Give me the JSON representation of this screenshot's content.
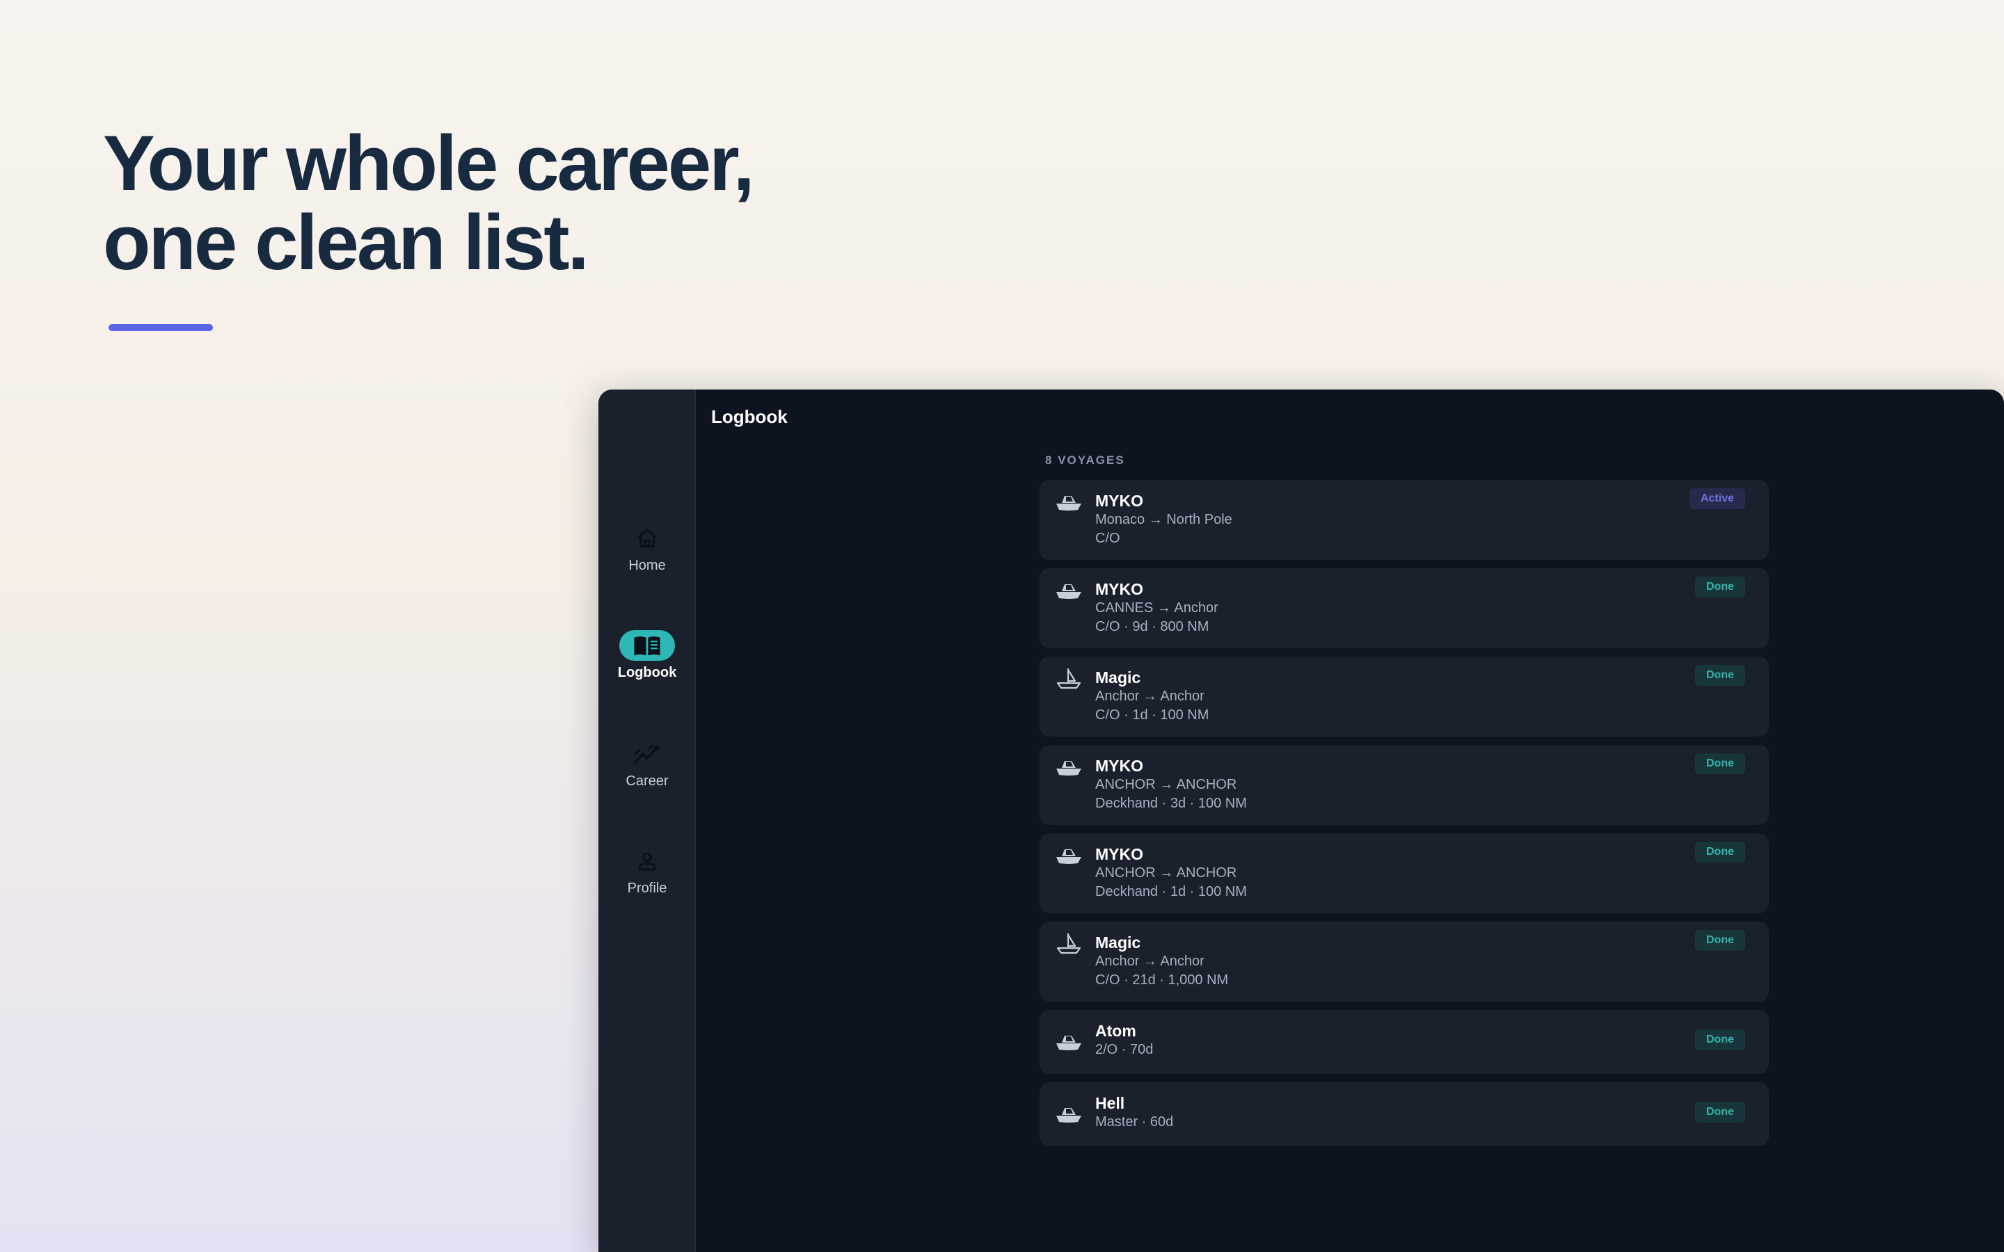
{
  "hero": {
    "line1": "Your whole career,",
    "line2": "one clean list.",
    "accent_color": "#5b65e6"
  },
  "app": {
    "nav": [
      {
        "id": "home",
        "label": "Home",
        "icon": "home-icon"
      },
      {
        "id": "logbook",
        "label": "Logbook",
        "icon": "book-icon",
        "active": true
      },
      {
        "id": "career",
        "label": "Career",
        "icon": "chart-trend-icon"
      },
      {
        "id": "profile",
        "label": "Profile",
        "icon": "person-icon"
      }
    ],
    "page_title": "Logbook",
    "list_count": "8 VOYAGES",
    "voyages": [
      {
        "name": "MYKO",
        "route": "Monaco → North Pole",
        "details": "C/O",
        "status": "Active",
        "icon": "motor-yacht-icon"
      },
      {
        "name": "MYKO",
        "route": "CANNES → Anchor",
        "details": "C/O · 9d · 800 NM",
        "status": "Done",
        "icon": "motor-yacht-icon"
      },
      {
        "name": "Magic",
        "route": "Anchor → Anchor",
        "details": "C/O · 1d · 100 NM",
        "status": "Done",
        "icon": "sailboat-icon"
      },
      {
        "name": "MYKO",
        "route": "ANCHOR → ANCHOR",
        "details": "Deckhand · 3d · 100 NM",
        "status": "Done",
        "icon": "motor-yacht-icon"
      },
      {
        "name": "MYKO",
        "route": "ANCHOR → ANCHOR",
        "details": "Deckhand · 1d · 100 NM",
        "status": "Done",
        "icon": "motor-yacht-icon"
      },
      {
        "name": "Magic",
        "route": "Anchor → Anchor",
        "details": "C/O · 21d · 1,000 NM",
        "status": "Done",
        "icon": "sailboat-icon"
      },
      {
        "name": "Atom",
        "details": "2/O · 70d",
        "status": "Done",
        "icon": "motor-yacht-icon"
      },
      {
        "name": "Hell",
        "details": "Master · 60d",
        "status": "Done",
        "icon": "motor-yacht-icon"
      }
    ],
    "colors": {
      "background": "#0e141f",
      "card": "#1a212d",
      "active_nav": "#2fb7b5",
      "done_badge": "#34b4ad",
      "active_badge": "#6f73e0"
    }
  }
}
